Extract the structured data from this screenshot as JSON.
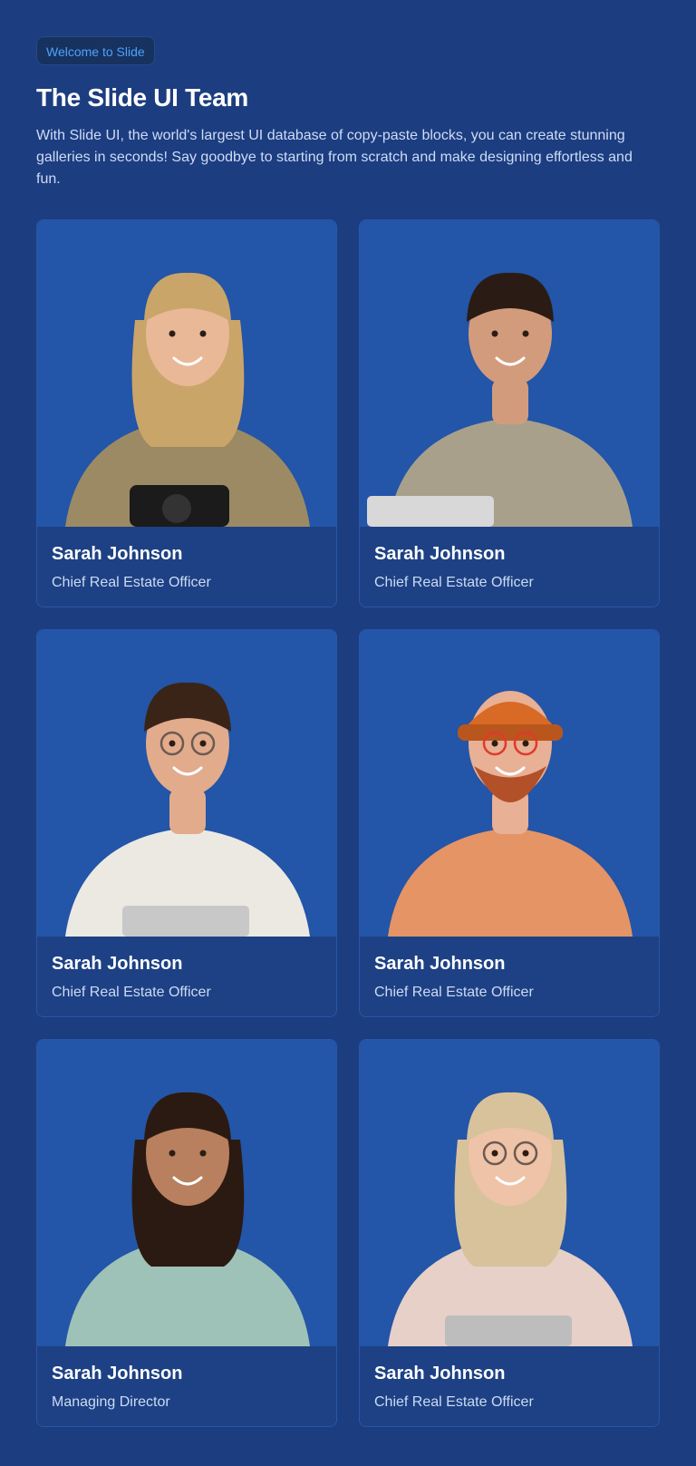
{
  "header": {
    "badge": "Welcome to Slide",
    "title": "The Slide UI Team",
    "description": "With Slide UI, the world's largest UI database of copy-paste blocks, you can create stunning galleries in seconds! Say goodbye to starting from scratch and make designing effortless and fun."
  },
  "team": [
    {
      "name": "Sarah Johnson",
      "role": "Chief Real Estate Officer",
      "avatar": "woman-blonde-camera",
      "hair": "#c9a56a",
      "skin": "#e9b896",
      "outfit": "#9c8a64",
      "accent": "#1b1b1b"
    },
    {
      "name": "Sarah Johnson",
      "role": "Chief Real Estate Officer",
      "avatar": "man-dark-hair-laptop",
      "hair": "#2a1c14",
      "skin": "#d29c7c",
      "outfit": "#a9a08c",
      "accent": "#d8d8d8"
    },
    {
      "name": "Sarah Johnson",
      "role": "Chief Real Estate Officer",
      "avatar": "man-glasses-laptop",
      "hair": "#3a2418",
      "skin": "#e2ab8c",
      "outfit": "#ece9e2",
      "accent": "#c8c8c8"
    },
    {
      "name": "Sarah Johnson",
      "role": "Chief Real Estate Officer",
      "avatar": "man-beanie-beard",
      "hair": "#d86a25",
      "skin": "#e8b094",
      "outfit": "#e59466",
      "accent": "#e03a2c"
    },
    {
      "name": "Sarah Johnson",
      "role": "Managing Director",
      "avatar": "woman-curly-dark-hair",
      "hair": "#2b1a12",
      "skin": "#b8805e",
      "outfit": "#9fc2b8",
      "accent": "#e0a080"
    },
    {
      "name": "Sarah Johnson",
      "role": "Chief Real Estate Officer",
      "avatar": "woman-blonde-glasses",
      "hair": "#d8c29c",
      "skin": "#efc3a8",
      "outfit": "#e6d0c8",
      "accent": "#bdbdbd"
    }
  ]
}
